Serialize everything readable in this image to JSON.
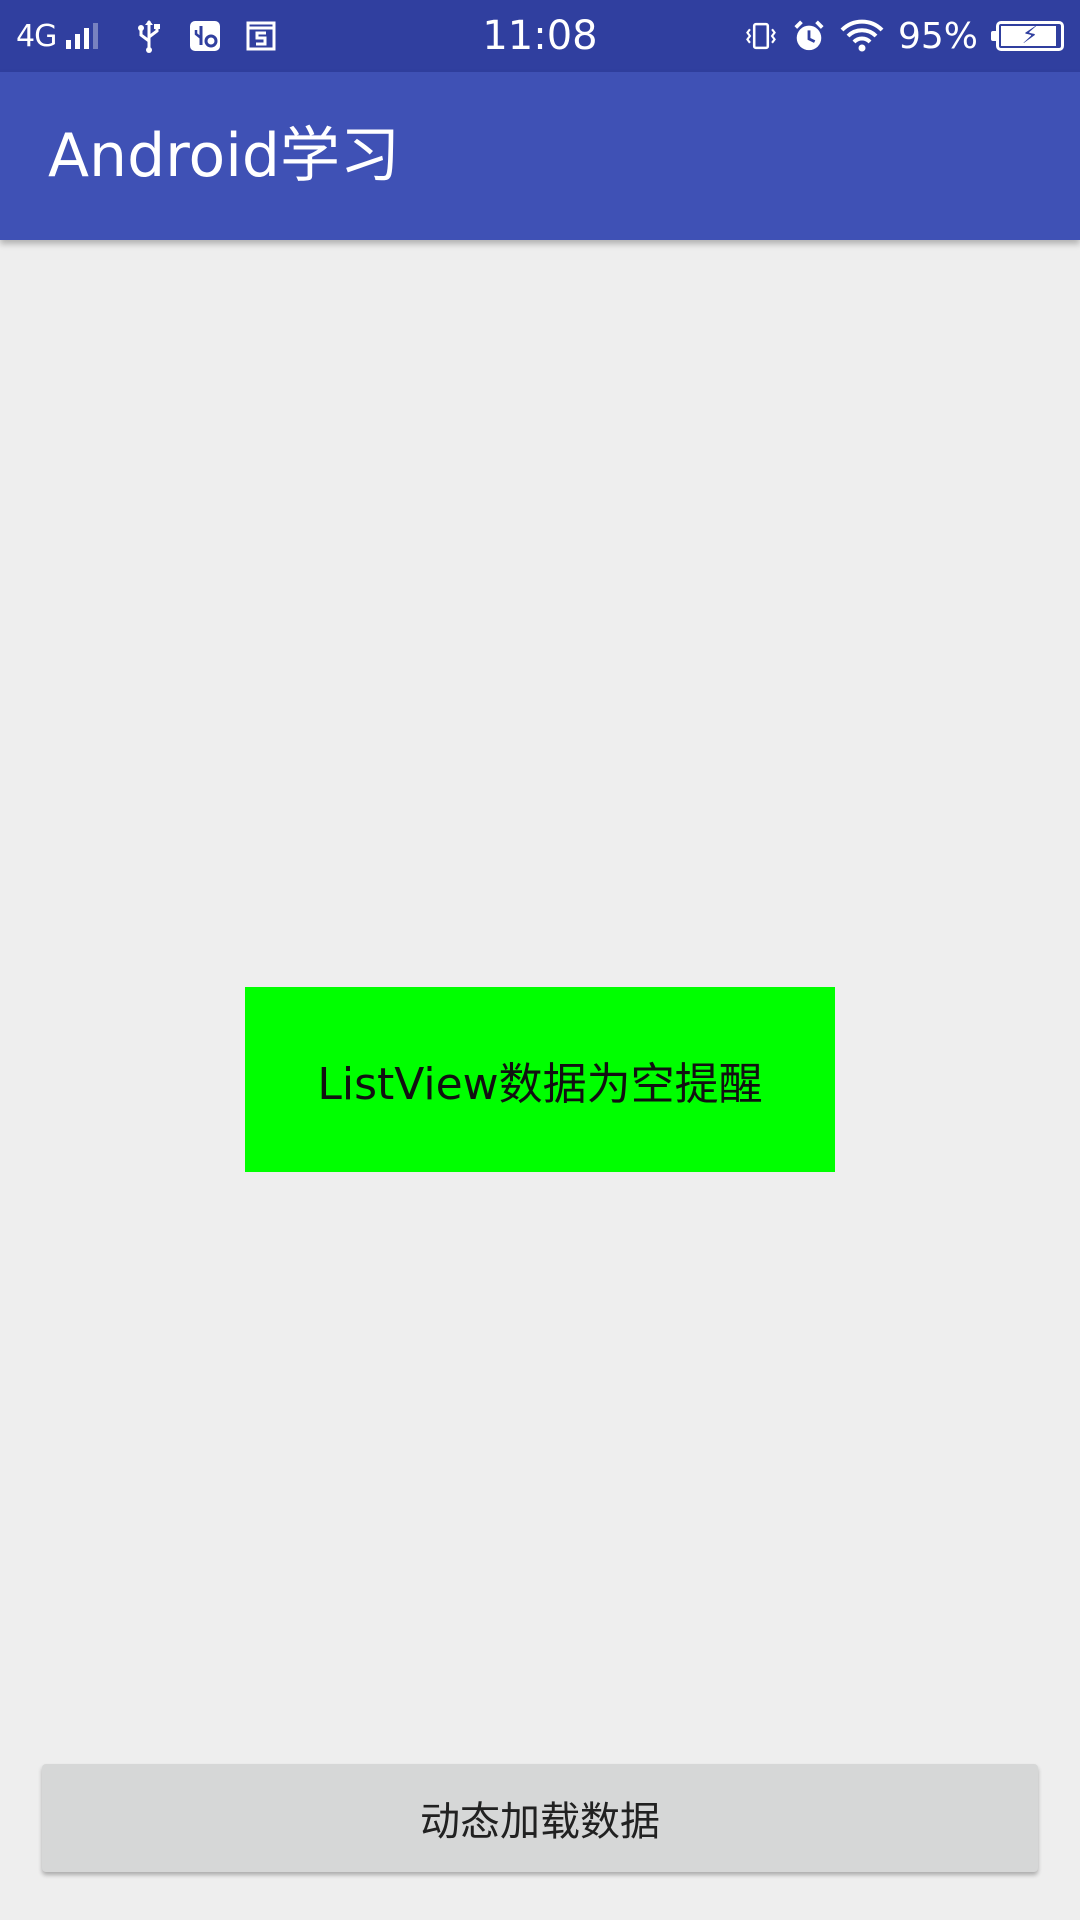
{
  "status_bar": {
    "network": "4G",
    "icons": [
      "signal-icon",
      "usb-icon",
      "usb-debug-icon",
      "screenshot-s-icon",
      "vibrate-icon",
      "alarm-icon",
      "wifi-icon",
      "battery-charging-icon"
    ],
    "time": "11:08",
    "battery_percent": "95%",
    "battery_level": 0.95,
    "background": "#303f9f"
  },
  "app_bar": {
    "title": "Android学习",
    "background": "#3f51b5"
  },
  "empty_view": {
    "text": "ListView数据为空提醒",
    "background": "#00ff00"
  },
  "load_button": {
    "label": "动态加载数据"
  }
}
